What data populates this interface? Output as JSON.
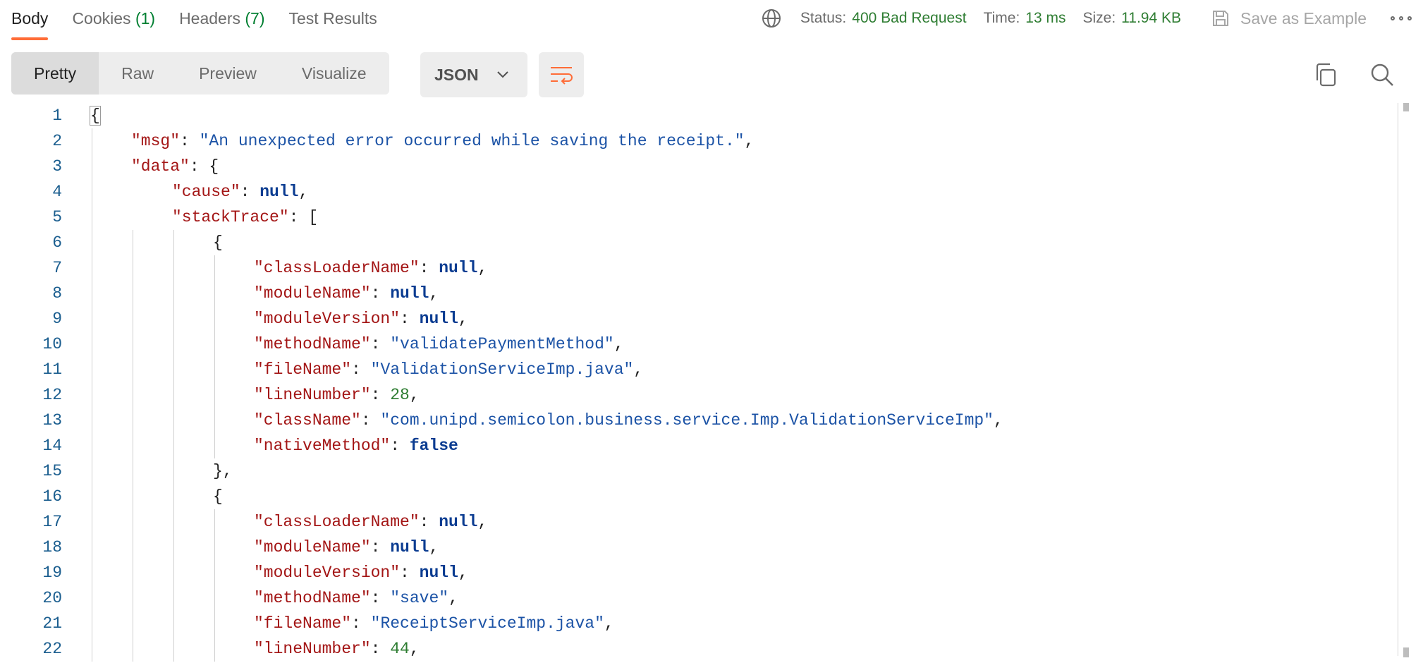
{
  "tabs": {
    "body": "Body",
    "cookies": "Cookies",
    "cookies_count": "(1)",
    "headers": "Headers",
    "headers_count": "(7)",
    "test_results": "Test Results"
  },
  "status": {
    "status_label": "Status:",
    "status_value": "400 Bad Request",
    "time_label": "Time:",
    "time_value": "13 ms",
    "size_label": "Size:",
    "size_value": "11.94 KB",
    "save_example": "Save as Example"
  },
  "view": {
    "modes": [
      "Pretty",
      "Raw",
      "Preview",
      "Visualize"
    ],
    "format": "JSON"
  },
  "colors": {
    "accent": "#ff6c37",
    "status_ok": "#2e7d32",
    "json_key": "#a31515",
    "json_string": "#1c53a6",
    "json_keyword": "#0b3c91",
    "line_number": "#1b5e8f"
  },
  "code_lines": [
    {
      "n": "1",
      "indent": 0,
      "tokens": [
        {
          "t": "p",
          "v": "{"
        }
      ]
    },
    {
      "n": "2",
      "indent": 1,
      "tokens": [
        {
          "t": "key",
          "v": "\"msg\""
        },
        {
          "t": "p",
          "v": ": "
        },
        {
          "t": "str",
          "v": "\"An unexpected error occurred while saving the receipt.\""
        },
        {
          "t": "p",
          "v": ","
        }
      ]
    },
    {
      "n": "3",
      "indent": 1,
      "tokens": [
        {
          "t": "key",
          "v": "\"data\""
        },
        {
          "t": "p",
          "v": ": {"
        }
      ]
    },
    {
      "n": "4",
      "indent": 2,
      "tokens": [
        {
          "t": "key",
          "v": "\"cause\""
        },
        {
          "t": "p",
          "v": ": "
        },
        {
          "t": "kw",
          "v": "null"
        },
        {
          "t": "p",
          "v": ","
        }
      ]
    },
    {
      "n": "5",
      "indent": 2,
      "tokens": [
        {
          "t": "key",
          "v": "\"stackTrace\""
        },
        {
          "t": "p",
          "v": ": ["
        }
      ]
    },
    {
      "n": "6",
      "indent": 3,
      "tokens": [
        {
          "t": "p",
          "v": "{"
        }
      ]
    },
    {
      "n": "7",
      "indent": 4,
      "tokens": [
        {
          "t": "key",
          "v": "\"classLoaderName\""
        },
        {
          "t": "p",
          "v": ": "
        },
        {
          "t": "kw",
          "v": "null"
        },
        {
          "t": "p",
          "v": ","
        }
      ]
    },
    {
      "n": "8",
      "indent": 4,
      "tokens": [
        {
          "t": "key",
          "v": "\"moduleName\""
        },
        {
          "t": "p",
          "v": ": "
        },
        {
          "t": "kw",
          "v": "null"
        },
        {
          "t": "p",
          "v": ","
        }
      ]
    },
    {
      "n": "9",
      "indent": 4,
      "tokens": [
        {
          "t": "key",
          "v": "\"moduleVersion\""
        },
        {
          "t": "p",
          "v": ": "
        },
        {
          "t": "kw",
          "v": "null"
        },
        {
          "t": "p",
          "v": ","
        }
      ]
    },
    {
      "n": "10",
      "indent": 4,
      "tokens": [
        {
          "t": "key",
          "v": "\"methodName\""
        },
        {
          "t": "p",
          "v": ": "
        },
        {
          "t": "str",
          "v": "\"validatePaymentMethod\""
        },
        {
          "t": "p",
          "v": ","
        }
      ]
    },
    {
      "n": "11",
      "indent": 4,
      "tokens": [
        {
          "t": "key",
          "v": "\"fileName\""
        },
        {
          "t": "p",
          "v": ": "
        },
        {
          "t": "str",
          "v": "\"ValidationServiceImp.java\""
        },
        {
          "t": "p",
          "v": ","
        }
      ]
    },
    {
      "n": "12",
      "indent": 4,
      "tokens": [
        {
          "t": "key",
          "v": "\"lineNumber\""
        },
        {
          "t": "p",
          "v": ": "
        },
        {
          "t": "num",
          "v": "28"
        },
        {
          "t": "p",
          "v": ","
        }
      ]
    },
    {
      "n": "13",
      "indent": 4,
      "tokens": [
        {
          "t": "key",
          "v": "\"className\""
        },
        {
          "t": "p",
          "v": ": "
        },
        {
          "t": "str",
          "v": "\"com.unipd.semicolon.business.service.Imp.ValidationServiceImp\""
        },
        {
          "t": "p",
          "v": ","
        }
      ]
    },
    {
      "n": "14",
      "indent": 4,
      "tokens": [
        {
          "t": "key",
          "v": "\"nativeMethod\""
        },
        {
          "t": "p",
          "v": ": "
        },
        {
          "t": "kw",
          "v": "false"
        }
      ]
    },
    {
      "n": "15",
      "indent": 3,
      "tokens": [
        {
          "t": "p",
          "v": "},"
        }
      ]
    },
    {
      "n": "16",
      "indent": 3,
      "tokens": [
        {
          "t": "p",
          "v": "{"
        }
      ]
    },
    {
      "n": "17",
      "indent": 4,
      "tokens": [
        {
          "t": "key",
          "v": "\"classLoaderName\""
        },
        {
          "t": "p",
          "v": ": "
        },
        {
          "t": "kw",
          "v": "null"
        },
        {
          "t": "p",
          "v": ","
        }
      ]
    },
    {
      "n": "18",
      "indent": 4,
      "tokens": [
        {
          "t": "key",
          "v": "\"moduleName\""
        },
        {
          "t": "p",
          "v": ": "
        },
        {
          "t": "kw",
          "v": "null"
        },
        {
          "t": "p",
          "v": ","
        }
      ]
    },
    {
      "n": "19",
      "indent": 4,
      "tokens": [
        {
          "t": "key",
          "v": "\"moduleVersion\""
        },
        {
          "t": "p",
          "v": ": "
        },
        {
          "t": "kw",
          "v": "null"
        },
        {
          "t": "p",
          "v": ","
        }
      ]
    },
    {
      "n": "20",
      "indent": 4,
      "tokens": [
        {
          "t": "key",
          "v": "\"methodName\""
        },
        {
          "t": "p",
          "v": ": "
        },
        {
          "t": "str",
          "v": "\"save\""
        },
        {
          "t": "p",
          "v": ","
        }
      ]
    },
    {
      "n": "21",
      "indent": 4,
      "tokens": [
        {
          "t": "key",
          "v": "\"fileName\""
        },
        {
          "t": "p",
          "v": ": "
        },
        {
          "t": "str",
          "v": "\"ReceiptServiceImp.java\""
        },
        {
          "t": "p",
          "v": ","
        }
      ]
    },
    {
      "n": "22",
      "indent": 4,
      "tokens": [
        {
          "t": "key",
          "v": "\"lineNumber\""
        },
        {
          "t": "p",
          "v": ": "
        },
        {
          "t": "num",
          "v": "44"
        },
        {
          "t": "p",
          "v": ","
        }
      ]
    }
  ]
}
